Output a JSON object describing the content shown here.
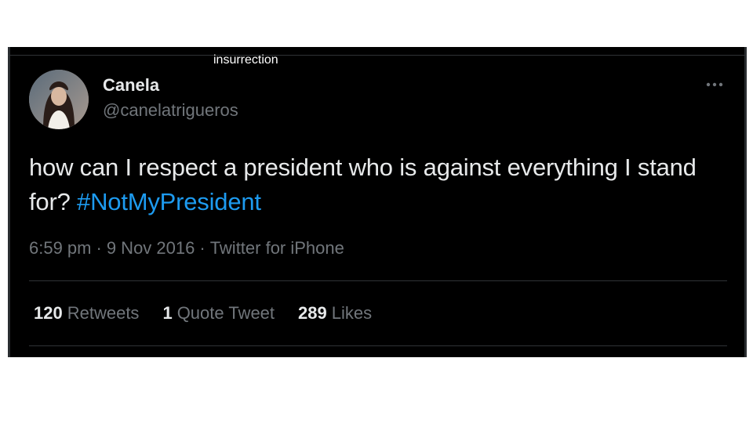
{
  "caption": "insurrection",
  "tweet": {
    "author": {
      "display_name": "Canela",
      "handle": "@canelatrigueros"
    },
    "text": "how can I respect a president who is against everything I stand for?",
    "hashtag": "#NotMyPresident",
    "time": "6:59 pm",
    "date": "9 Nov 2016",
    "source": "Twitter for iPhone",
    "separator": "·",
    "stats": {
      "retweets_count": "120",
      "retweets_label": "Retweets",
      "quote_count": "1",
      "quote_label": "Quote Tweet",
      "likes_count": "289",
      "likes_label": "Likes"
    }
  },
  "colors": {
    "background": "#000000",
    "text": "#e7e9ea",
    "muted": "#71767b",
    "link": "#1d9bf0",
    "divider": "#2f3336"
  },
  "icons": {
    "more": "more-horizontal-icon"
  }
}
